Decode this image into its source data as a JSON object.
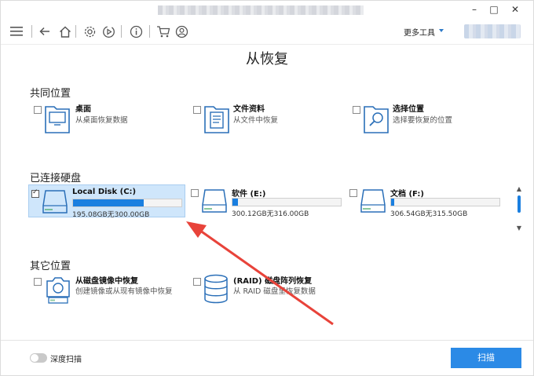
{
  "window": {
    "minimize": "–",
    "maximize": "□",
    "close": "✕"
  },
  "toolbar": {
    "more_tools": "更多工具"
  },
  "page_title": "从恢复",
  "common": {
    "title": "共同位置",
    "items": [
      {
        "name": "桌面",
        "desc": "从桌面恢复数据",
        "icon": "desktop-folder-icon"
      },
      {
        "name": "文件资料",
        "desc": "从文件中恢复",
        "icon": "documents-folder-icon"
      },
      {
        "name": "选择位置",
        "desc": "选择要恢复的位置",
        "icon": "search-folder-icon"
      }
    ]
  },
  "disks": {
    "title": "已连接硬盘",
    "items": [
      {
        "name": "Local Disk (C:)",
        "size": "195.08GB无300.00GB",
        "used_fraction": 0.65,
        "checked": true
      },
      {
        "name": "软件 (E:)",
        "size": "300.12GB无316.00GB",
        "used_fraction": 0.05,
        "checked": false
      },
      {
        "name": "文档 (F:)",
        "size": "306.54GB无315.50GB",
        "used_fraction": 0.03,
        "checked": false
      }
    ]
  },
  "other": {
    "title": "其它位置",
    "items": [
      {
        "name": "从磁盘镜像中恢复",
        "desc": "创建镜像或从现有镜像中恢复",
        "icon": "camera-disk-icon"
      },
      {
        "name": "(RAID) 磁盘阵列恢复",
        "desc": "从 RAID 磁盘里恢复数据",
        "icon": "database-icon"
      }
    ]
  },
  "footer": {
    "deep_scan_label": "深度扫描",
    "scan_button": "扫描"
  },
  "colors": {
    "accent": "#1a7fe0",
    "annotation_arrow": "#e8433a"
  }
}
